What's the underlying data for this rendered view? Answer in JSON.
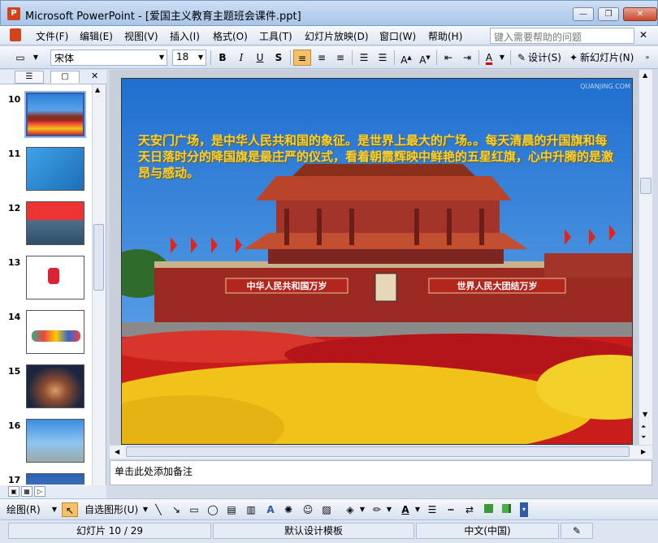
{
  "window": {
    "title": "Microsoft PowerPoint - [爱国主义教育主题班会课件.ppt]",
    "app_icon": "P",
    "minimize": "—",
    "restore": "❐",
    "close": "✕"
  },
  "menu": {
    "items": [
      "文件(F)",
      "编辑(E)",
      "视图(V)",
      "插入(I)",
      "格式(O)",
      "工具(T)",
      "幻灯片放映(D)",
      "窗口(W)",
      "帮助(H)"
    ],
    "help_placeholder": "键入需要帮助的问题",
    "close_doc": "✕"
  },
  "toolbar": {
    "font_name": "宋体",
    "font_size": "18",
    "bold": "B",
    "italic": "I",
    "underline": "U",
    "shadow": "S",
    "design_label": "设计(S)",
    "new_slide_label": "新幻灯片(N)"
  },
  "slides": {
    "numbers": [
      "10",
      "11",
      "12",
      "13",
      "14",
      "15",
      "16",
      "17"
    ],
    "selected": "10"
  },
  "current_slide": {
    "text": "天安门广场，是中华人民共和国的象征。是世界上最大的广场。。每天清晨的升国旗和每天日落时分的降国旗是最庄严的仪式，看着朝霞辉映中鲜艳的五星红旗，心中升腾的是激昂与感动。",
    "watermark": "QUANJING.COM",
    "banner_left": "中华人民共和国万岁",
    "banner_right": "世界人民大团结万岁"
  },
  "notes": {
    "placeholder": "单击此处添加备注"
  },
  "drawing": {
    "draw_label": "绘图(R)",
    "autoshapes_label": "自选图形(U)"
  },
  "status": {
    "slide_info": "幻灯片 10 / 29",
    "template": "默认设计模板",
    "language": "中文(中国)"
  },
  "colors": {
    "accent": "#2e5aa8",
    "slide_text": "#f6d13a"
  }
}
